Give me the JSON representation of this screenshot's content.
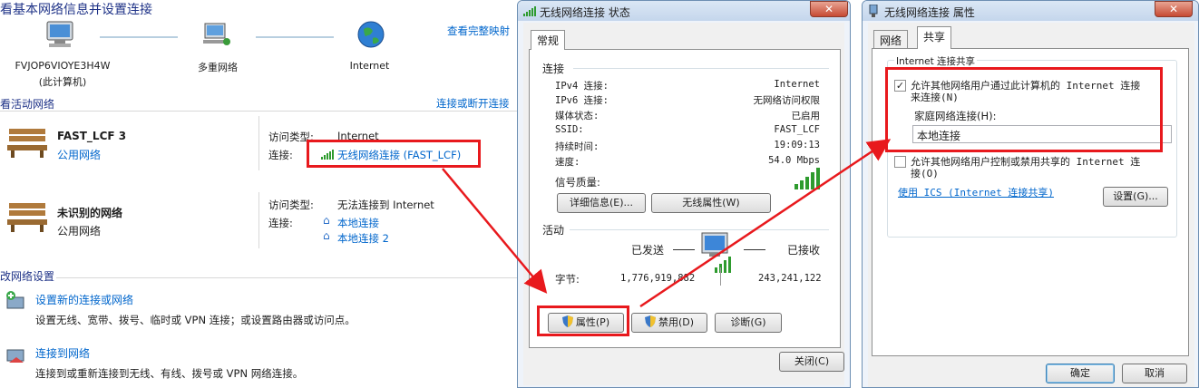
{
  "left": {
    "header": "看基本网络信息并设置连接",
    "full_map_link": "查看完整映射",
    "map": {
      "computer_name": "FVJOP6VIOYE3H4W",
      "computer_sub": "(此计算机)",
      "multi_network": "多重网络",
      "internet": "Internet"
    },
    "active_networks_label": "看活动网络",
    "connect_disconnect_link": "连接或断开连接",
    "networks": [
      {
        "name": "FAST_LCF  3",
        "type": "公用网络",
        "access_type_label": "访问类型:",
        "access_type_value": "Internet",
        "connection_label": "连接:",
        "connections": [
          "无线网络连接 (FAST_LCF)"
        ]
      },
      {
        "name": "未识别的网络",
        "type": "公用网络",
        "access_type_label": "访问类型:",
        "access_type_value": "无法连接到 Internet",
        "connection_label": "连接:",
        "connections": [
          "本地连接",
          "本地连接 2"
        ]
      }
    ],
    "settings_label": "改网络设置",
    "tasks": [
      {
        "title": "设置新的连接或网络",
        "desc": "设置无线、宽带、拨号、临时或 VPN 连接；或设置路由器或访问点。"
      },
      {
        "title": "连接到网络",
        "desc": "连接到或重新连接到无线、有线、拨号或 VPN 网络连接。"
      }
    ]
  },
  "status_dialog": {
    "title": "无线网络连接 状态",
    "close": "✕",
    "tab": "常规",
    "connection_group": "连接",
    "rows": [
      {
        "label": "IPv4 连接:",
        "value": "Internet"
      },
      {
        "label": "IPv6 连接:",
        "value": "无网络访问权限"
      },
      {
        "label": "媒体状态:",
        "value": "已启用"
      },
      {
        "label": "SSID:",
        "value": "FAST_LCF"
      },
      {
        "label": "持续时间:",
        "value": "19:09:13"
      },
      {
        "label": "速度:",
        "value": "54.0 Mbps"
      }
    ],
    "signal_label": "信号质量:",
    "details_button": "详细信息(E)...",
    "wireless_props_button": "无线属性(W)",
    "activity_group": "活动",
    "sent_label": "已发送",
    "received_label": "已接收",
    "bytes_label": "字节:",
    "bytes_sent": "1,776,919,882",
    "bytes_received": "243,241,122",
    "properties_button": "属性(P)",
    "disable_button": "禁用(D)",
    "diagnose_button": "诊断(G)",
    "close_button": "关闭(C)"
  },
  "props_dialog": {
    "title": "无线网络连接 属性",
    "close": "✕",
    "tabs": [
      "网络",
      "共享"
    ],
    "group": "Internet 连接共享",
    "allow_share_line1": "允许其他网络用户通过此计算机的 Internet 连接",
    "allow_share_line2": "来连接(N)",
    "allow_share_checked": true,
    "home_label": "家庭网络连接(H):",
    "home_value": "本地连接",
    "allow_control_line1": "允许其他网络用户控制或禁用共享的 Internet 连",
    "allow_control_line2": "接(O)",
    "allow_control_checked": false,
    "ics_link": "使用 ICS (Internet 连接共享)",
    "settings_button": "设置(G)...",
    "ok_button": "确定",
    "cancel_button": "取消"
  },
  "colors": {
    "accent_red": "#e8191d",
    "link_blue": "#0066cc",
    "signal_green": "#2e9b2e"
  }
}
